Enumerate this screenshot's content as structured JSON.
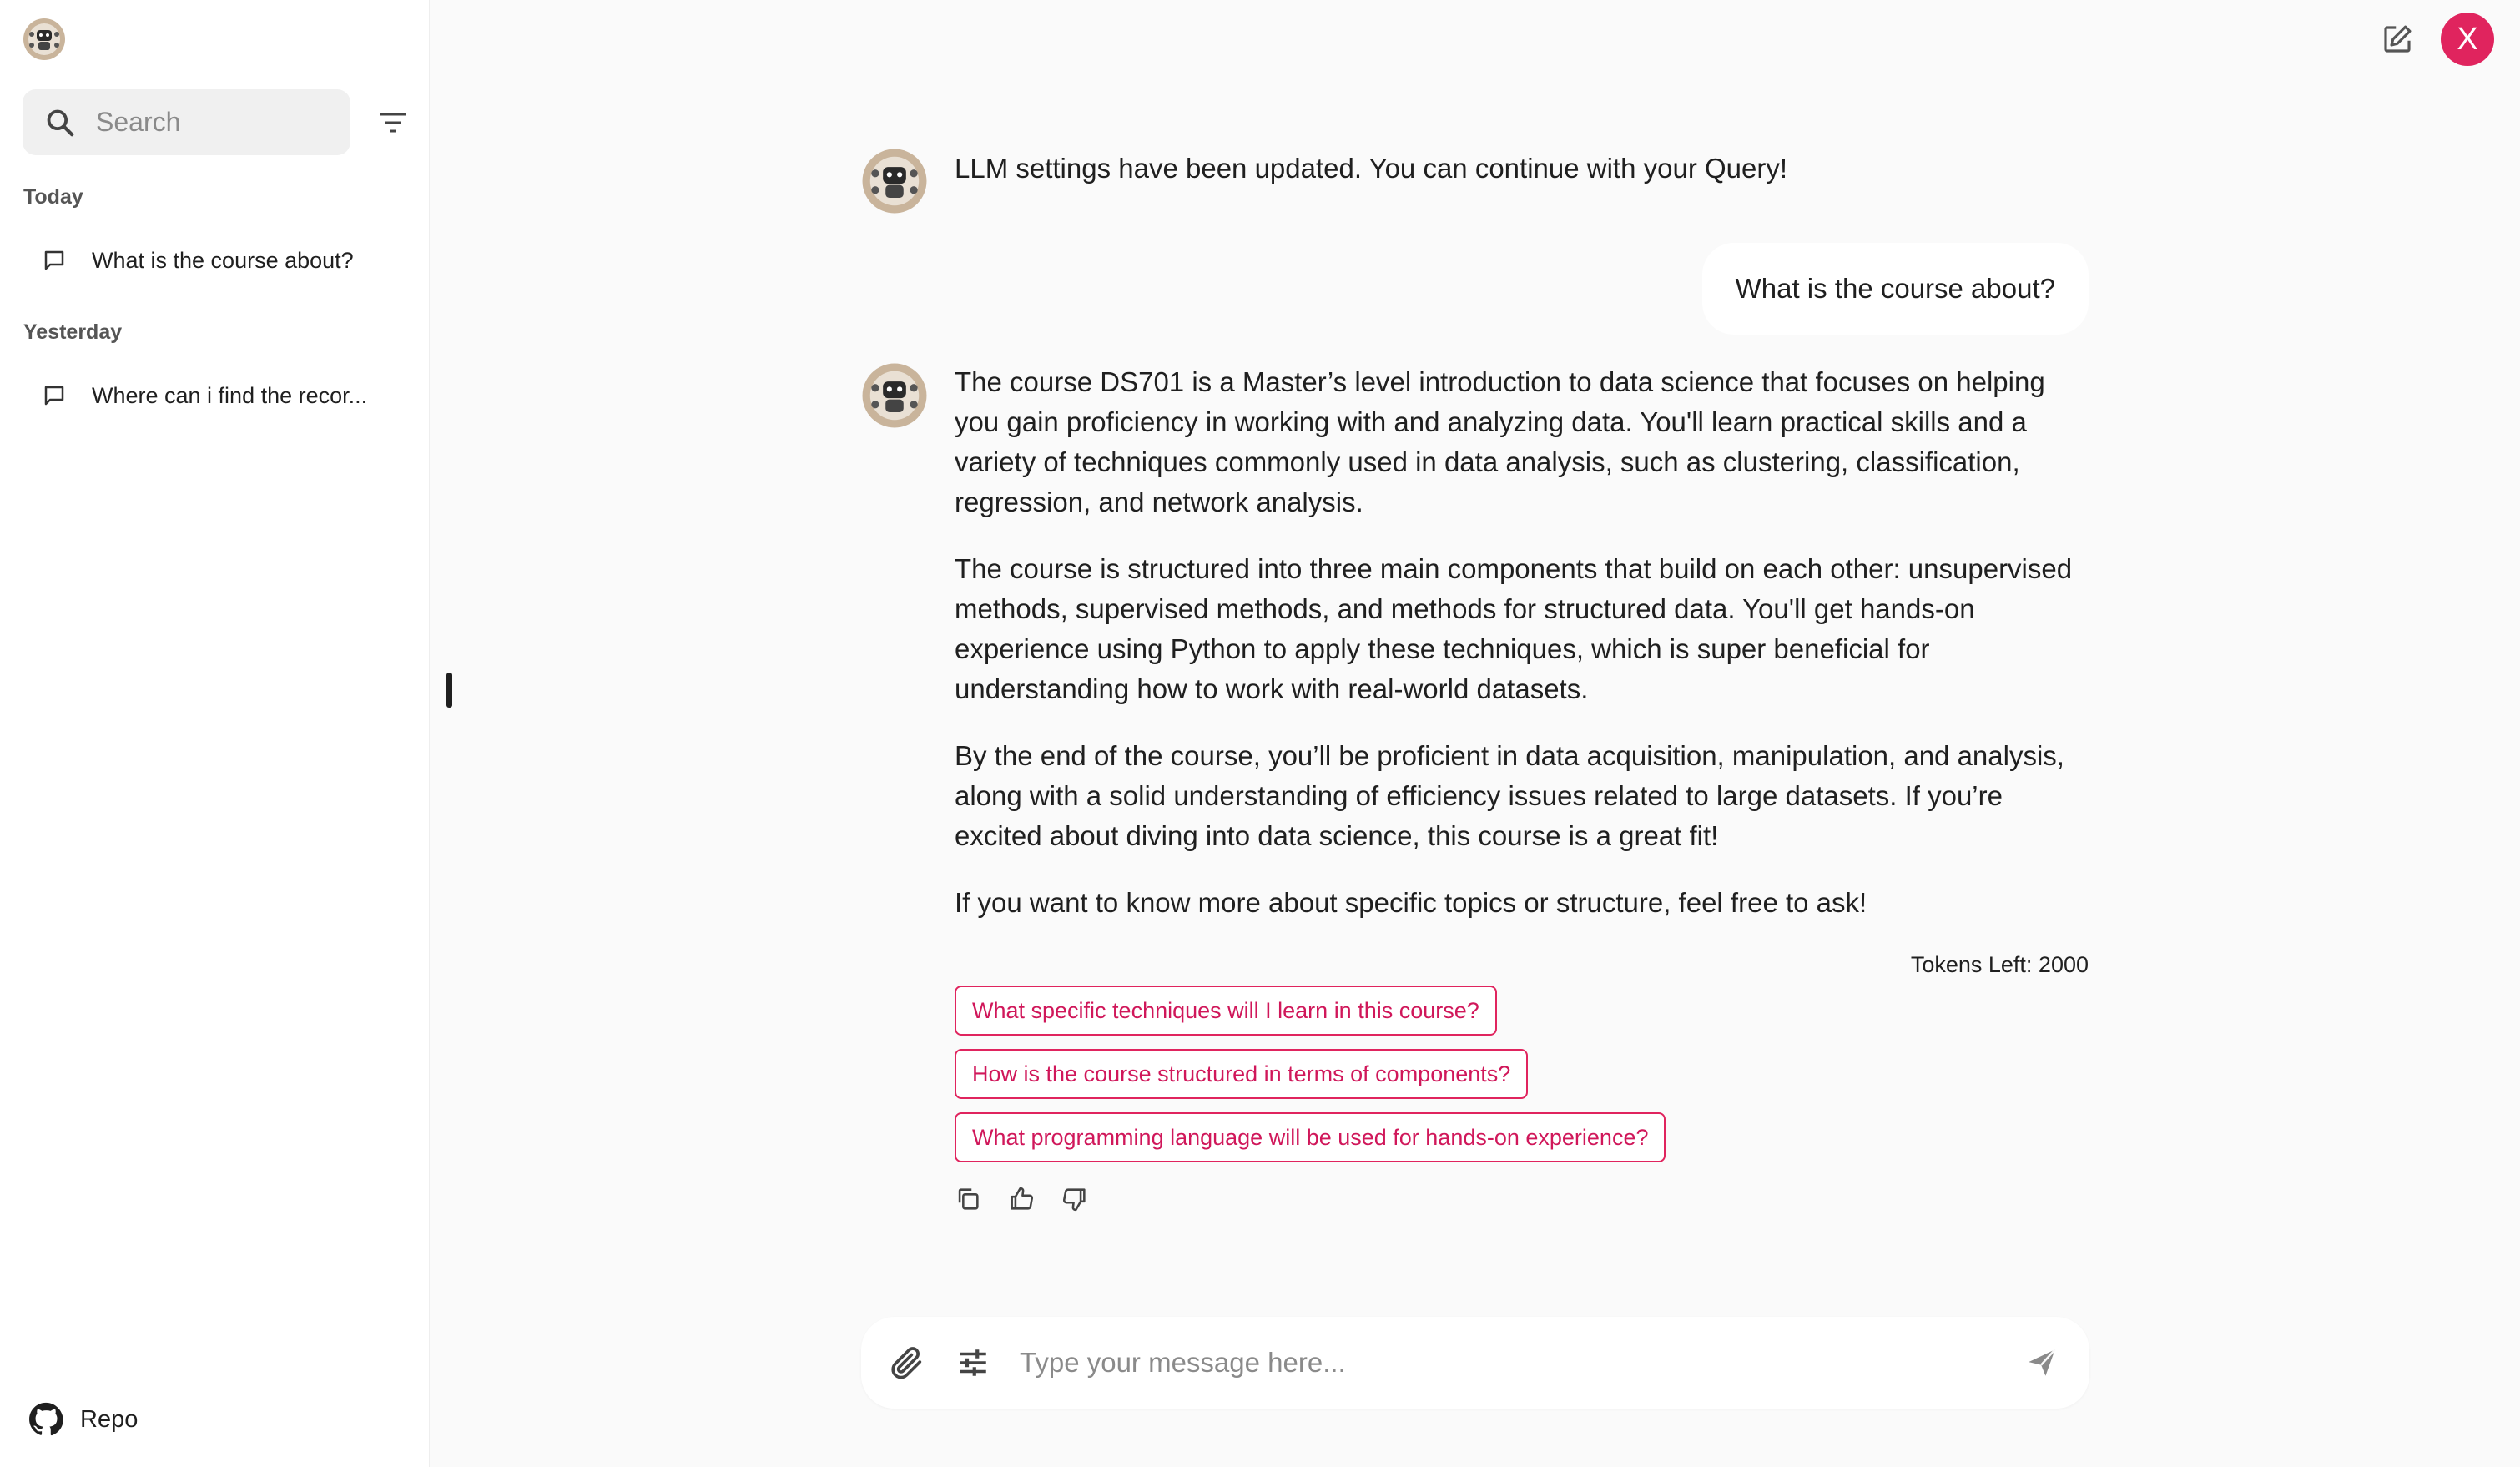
{
  "sidebar": {
    "search_placeholder": "Search",
    "groups": [
      {
        "label": "Today",
        "items": [
          "What is the course about?"
        ]
      },
      {
        "label": "Yesterday",
        "items": [
          "Where can i find the recor..."
        ]
      }
    ],
    "repo_label": "Repo"
  },
  "header": {
    "user_initial": "X"
  },
  "chat": {
    "system_message": "LLM settings have been updated. You can continue with your Query!",
    "user_message": "What is the course about?",
    "bot_paragraphs": [
      "The course DS701 is a Master’s level introduction to data science that focuses on helping you gain proficiency in working with and analyzing data. You'll learn practical skills and a variety of techniques commonly used in data analysis, such as clustering, classification, regression, and network analysis.",
      "The course is structured into three main components that build on each other: unsupervised methods, supervised methods, and methods for structured data. You'll get hands-on experience using Python to apply these techniques, which is super beneficial for understanding how to work with real-world datasets.",
      "By the end of the course, you’ll be proficient in data acquisition, manipulation, and analysis, along with a solid understanding of efficiency issues related to large datasets. If you’re excited about diving into data science, this course is a great fit!",
      "If you want to know more about specific topics or structure, feel free to ask!"
    ],
    "tokens_left": "Tokens Left: 2000",
    "suggestions": [
      "What specific techniques will I learn in this course?",
      "How is the course structured in terms of components?",
      "What programming language will be used for hands-on experience?"
    ]
  },
  "composer": {
    "placeholder": "Type your message here..."
  },
  "colors": {
    "accent": "#e0245e",
    "sidebar_bg": "#ffffff",
    "main_bg": "#fafafa"
  },
  "icons": [
    "bot-logo-icon",
    "search-icon",
    "filter-icon",
    "chat-bubble-icon",
    "github-icon",
    "edit-icon",
    "copy-icon",
    "thumbs-up-icon",
    "thumbs-down-icon",
    "paperclip-icon",
    "tune-icon",
    "send-icon"
  ]
}
